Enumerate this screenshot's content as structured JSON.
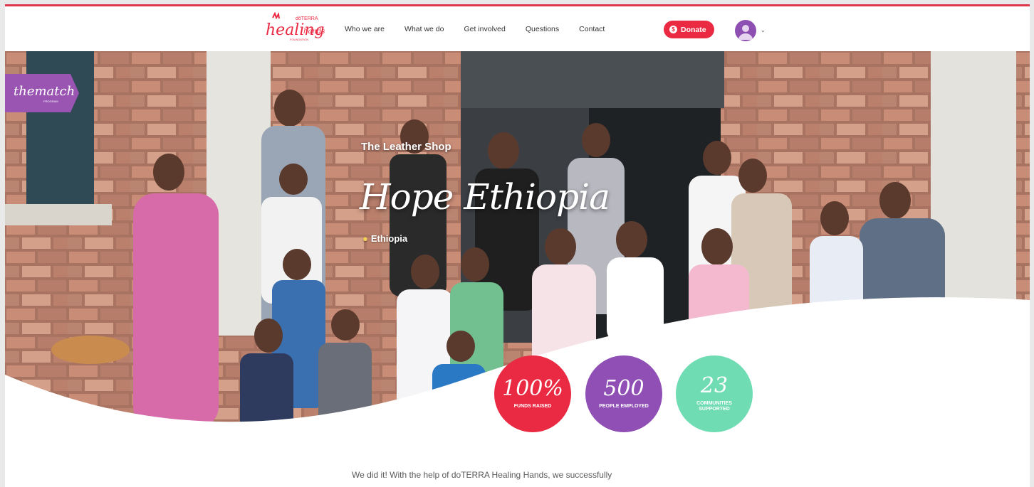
{
  "header": {
    "logo": {
      "brand_small": "dōTERRA",
      "brand_main": "healing",
      "brand_sub": "hands",
      "brand_tag": "FOUNDATION"
    },
    "nav": [
      {
        "label": "Who we are"
      },
      {
        "label": "What we do"
      },
      {
        "label": "Get involved"
      },
      {
        "label": "Questions"
      },
      {
        "label": "Contact"
      }
    ],
    "donate_label": "Donate",
    "donate_icon": "$"
  },
  "hero": {
    "badge_label": "thematch",
    "badge_sub": "PROGRAM",
    "subtitle": "The Leather Shop",
    "title": "Hope Ethiopia",
    "location": "Ethiopia"
  },
  "stats": [
    {
      "value": "100%",
      "label": "FUNDS RAISED",
      "color": "#ea2a42"
    },
    {
      "value": "500",
      "label": "PEOPLE EMPLOYED",
      "color": "#8f4fb5"
    },
    {
      "value": "23",
      "label": "COMMUNITIES SUPPORTED",
      "color": "#6fdcb4"
    }
  ],
  "body": {
    "intro": "We did it! With the help of doTERRA Healing Hands, we successfully"
  },
  "colors": {
    "accent": "#ea2a42",
    "purple": "#8f4fb5",
    "mint": "#6fdcb4"
  }
}
